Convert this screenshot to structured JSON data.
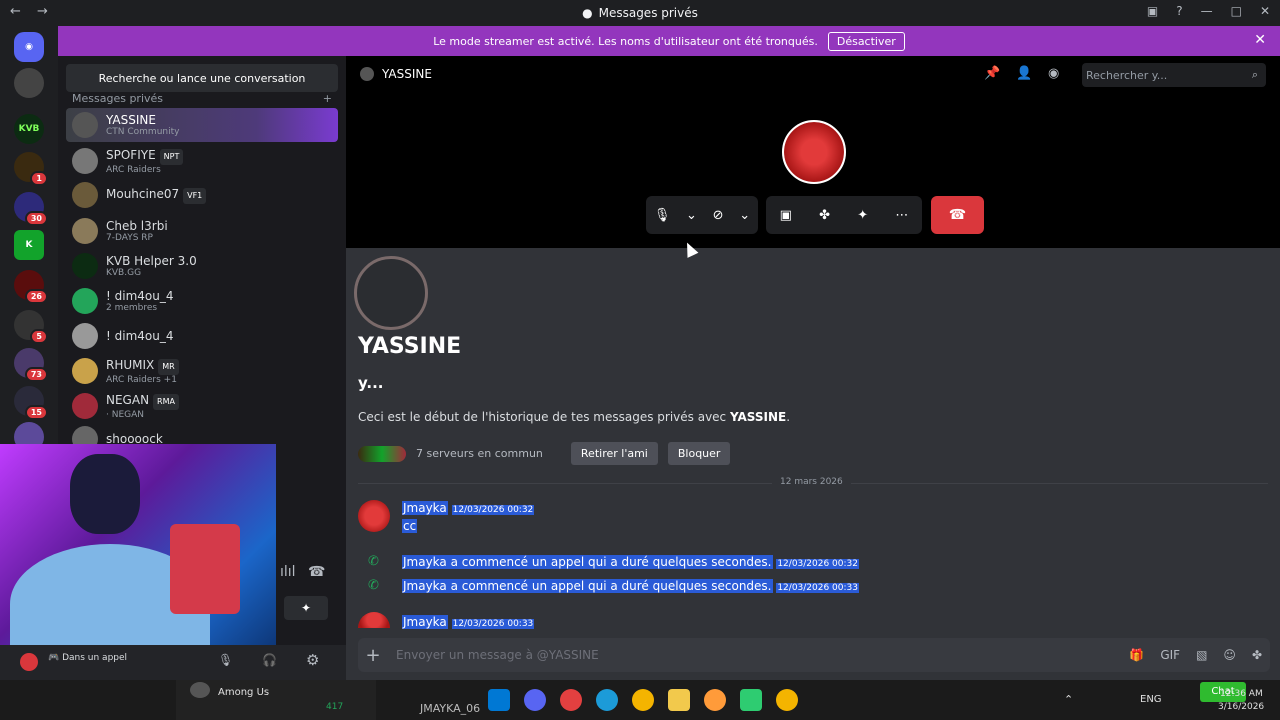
{
  "window": {
    "title": "Messages privés"
  },
  "banner": {
    "text": "Le mode streamer est activé. Les noms d'utilisateur ont été tronqués.",
    "button": "Désactiver"
  },
  "guild_badges": [
    "1",
    "30",
    "26",
    "5",
    "73",
    "15"
  ],
  "guild_labels": [
    "KVB"
  ],
  "dm_panel": {
    "search_label": "Recherche ou lance une conversation",
    "header": "Messages privés",
    "items": [
      {
        "name": "YASSINE",
        "sub": "CTN Community"
      },
      {
        "name": "SPOFIYE",
        "sub": "ARC Raiders",
        "tag": "NPT"
      },
      {
        "name": "Mouhcine07",
        "sub": "",
        "tag": "VF1"
      },
      {
        "name": "Cheb l3rbi",
        "sub": "7-DAYS RP"
      },
      {
        "name": "KVB Helper 3.0",
        "sub": "KVB.GG"
      },
      {
        "name": "! dim4ou_4",
        "sub": "2 membres"
      },
      {
        "name": "! dim4ou_4",
        "sub": ""
      },
      {
        "name": "RHUMIX",
        "sub": "ARC Raiders +1",
        "tag": "MR"
      },
      {
        "name": "NEGAN",
        "sub": "· NEGAN",
        "tag": "RMA"
      },
      {
        "name": "shoooock",
        "sub": ""
      }
    ]
  },
  "user_panel": {
    "voice_status": "Dans un appel"
  },
  "main": {
    "topbar_name": "YASSINE",
    "search_placeholder": "Rechercher y...",
    "profile": {
      "display_name": "YASSINE",
      "username": "y...",
      "intro_prefix": "Ceci est le début de l'historique de tes messages privés avec ",
      "intro_name": "YASSINE",
      "intro_suffix": ".",
      "mutual": "7 serveurs en commun",
      "remove_friend": "Retirer l'ami",
      "block": "Bloquer"
    },
    "date_divider": "12 mars 2026",
    "messages": [
      {
        "author": "Jmayka",
        "time": "12/03/2026 00:32",
        "text": "cc"
      },
      {
        "system": "Jmayka a commencé un appel qui a duré quelques secondes.",
        "time": "12/03/2026 00:32"
      },
      {
        "system": "Jmayka a commencé un appel qui a duré quelques secondes.",
        "time": "12/03/2026 00:33"
      },
      {
        "author": "Jmayka",
        "time": "12/03/2026 00:33"
      }
    ],
    "input_placeholder": "Envoyer un message à @YASSINE"
  },
  "taskbar": {
    "lang": "ENG",
    "time": "12:36 AM",
    "date": "3/16/2026",
    "popup_title": "Among Us",
    "channel_text": "JMAYKA_06",
    "chat_label": "Chat",
    "counts": [
      "417"
    ]
  },
  "colors": {
    "accent": "#9336bd",
    "danger": "#da373c",
    "highlight": "#2a5bd7",
    "online": "#23a55a"
  }
}
